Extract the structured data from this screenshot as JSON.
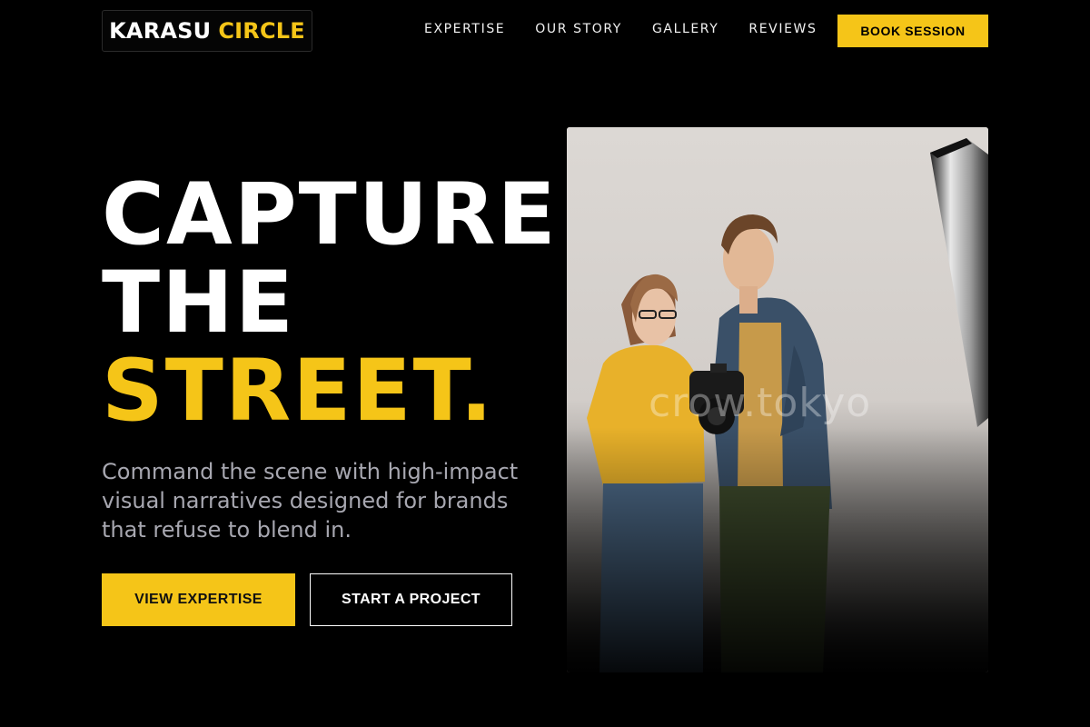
{
  "brand": {
    "word1": "KARASU",
    "word2": "CIRCLE"
  },
  "nav": {
    "items": [
      "EXPERTISE",
      "OUR STORY",
      "GALLERY",
      "REVIEWS"
    ],
    "cta": "BOOK SESSION"
  },
  "hero": {
    "line1": "CAPTURE",
    "line2": "THE",
    "line3": "STREET.",
    "subtitle": "Command the scene with high-impact visual narratives designed for brands that refuse to blend in.",
    "primary_button": "VIEW EXPERTISE",
    "secondary_button": "START A PROJECT",
    "image_watermark": "crow.tokyo"
  },
  "colors": {
    "accent": "#f5c518",
    "background": "#000000",
    "subtitle": "#a7a7b0"
  }
}
